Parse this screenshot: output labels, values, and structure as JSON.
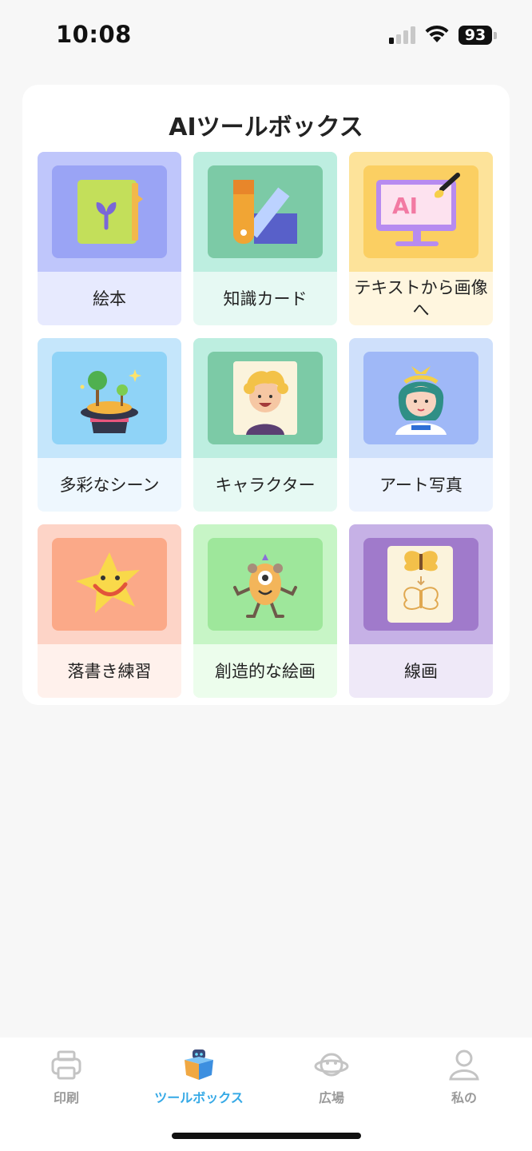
{
  "status_bar": {
    "time": "10:08",
    "battery": "93"
  },
  "toolbox": {
    "title": "AIツールボックス",
    "tools": [
      {
        "label": "絵本",
        "icon": "picture-book-icon",
        "outer": "#bfc6fb",
        "inner": "#9aa4f5",
        "bottom": "#e7eafe"
      },
      {
        "label": "知識カード",
        "icon": "color-swatch-icon",
        "outer": "#bdeee0",
        "inner": "#7ccaa6",
        "bottom": "#e6f9f3"
      },
      {
        "label": "テキストから画像へ",
        "icon": "ai-monitor-icon",
        "outer": "#fde39a",
        "inner": "#fbcf62",
        "bottom": "#fff6df"
      },
      {
        "label": "多彩なシーン",
        "icon": "magic-hat-island-icon",
        "outer": "#c5e6fb",
        "inner": "#8fd3f7",
        "bottom": "#eef7fe"
      },
      {
        "label": "キャラクター",
        "icon": "character-portrait-icon",
        "outer": "#bdeee0",
        "inner": "#7ccaa6",
        "bottom": "#e6f9f3"
      },
      {
        "label": "アート写真",
        "icon": "art-photo-girl-icon",
        "outer": "#cfe0fb",
        "inner": "#9fb8f7",
        "bottom": "#edf3fe"
      },
      {
        "label": "落書き練習",
        "icon": "doodle-star-icon",
        "outer": "#fdd4c7",
        "inner": "#fba988",
        "bottom": "#fff1ec"
      },
      {
        "label": "創造的な絵画",
        "icon": "monster-icon",
        "outer": "#c7f5c6",
        "inner": "#9ee79b",
        "bottom": "#ecfdec"
      },
      {
        "label": "線画",
        "icon": "butterfly-lineart-icon",
        "outer": "#c6b1e6",
        "inner": "#a07acb",
        "bottom": "#efe9f8"
      }
    ]
  },
  "tab_bar": {
    "tabs": [
      {
        "label": "印刷",
        "icon": "printer-icon",
        "active": false
      },
      {
        "label": "ツールボックス",
        "icon": "toolbox-icon",
        "active": true
      },
      {
        "label": "広場",
        "icon": "planet-icon",
        "active": false
      },
      {
        "label": "私の",
        "icon": "person-icon",
        "active": false
      }
    ]
  },
  "colors": {
    "active_tab": "#35a9e6",
    "inactive_tab": "#9a9a9a"
  }
}
